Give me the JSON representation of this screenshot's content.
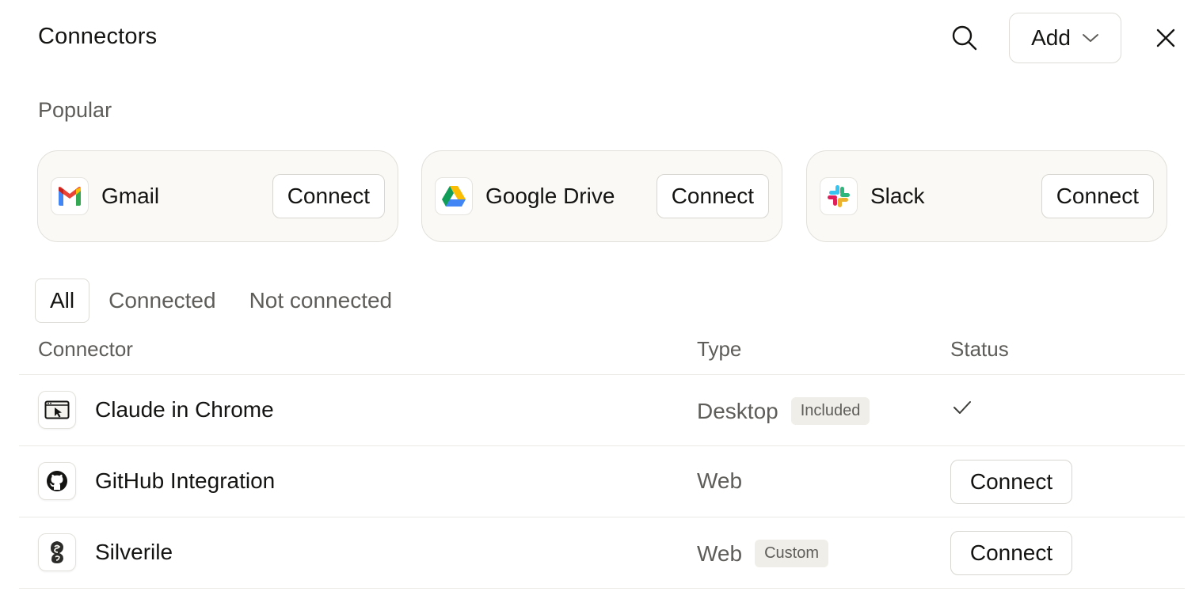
{
  "header": {
    "title": "Connectors",
    "add_label": "Add"
  },
  "popular": {
    "label": "Popular",
    "cards": [
      {
        "name": "Gmail",
        "icon": "gmail-icon",
        "button": "Connect"
      },
      {
        "name": "Google Drive",
        "icon": "google-drive-icon",
        "button": "Connect"
      },
      {
        "name": "Slack",
        "icon": "slack-icon",
        "button": "Connect"
      }
    ]
  },
  "tabs": [
    {
      "label": "All",
      "active": true
    },
    {
      "label": "Connected",
      "active": false
    },
    {
      "label": "Not connected",
      "active": false
    }
  ],
  "table": {
    "columns": [
      "Connector",
      "Type",
      "Status"
    ],
    "rows": [
      {
        "name": "Claude in Chrome",
        "icon": "browser-cursor-icon",
        "type": "Desktop",
        "badge": "Included",
        "status": "connected",
        "status_icon": "check-icon"
      },
      {
        "name": "GitHub Integration",
        "icon": "github-icon",
        "type": "Web",
        "badge": "",
        "status": "Connect"
      },
      {
        "name": "Silverile",
        "icon": "silverile-icon",
        "type": "Web",
        "badge": "Custom",
        "status": "Connect"
      }
    ]
  },
  "colors": {
    "text": "#141413",
    "muted": "#5e5d59",
    "border": "#dedcd6",
    "card_bg": "#faf9f6",
    "badge_bg": "#f0eee9"
  }
}
